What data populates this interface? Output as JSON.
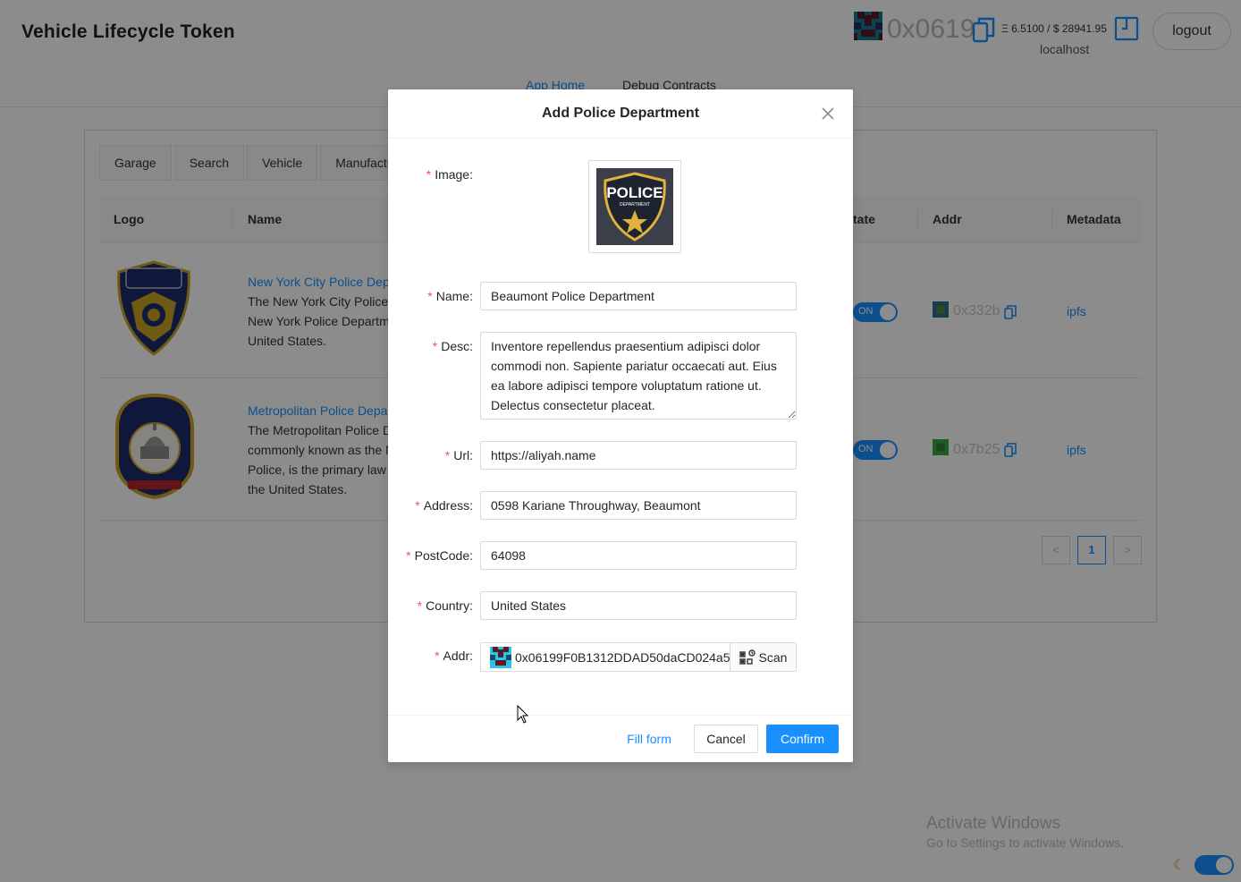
{
  "header": {
    "title": "Vehicle Lifecycle Token",
    "account_short": "0x0619",
    "balance": "Ξ 6.5100 / $ 28941.95",
    "network": "localhost",
    "logout_label": "logout",
    "nav": [
      "App Home",
      "Debug Contracts"
    ]
  },
  "tabs": [
    "Garage",
    "Search",
    "Vehicle",
    "Manufactur"
  ],
  "table": {
    "columns": [
      "Logo",
      "Name",
      "tate",
      "Addr",
      "Metadata"
    ],
    "rows": [
      {
        "name": "New York City Police Depa",
        "desc": [
          "The New York City Police",
          "New York Police Departm",
          "United States."
        ],
        "status": "ON",
        "addr": "0x332b",
        "metadata": "ipfs"
      },
      {
        "name": "Metropolitan Police Depa",
        "desc": [
          "The Metropolitan Police D",
          "commonly known as the M",
          "Police, is the primary law",
          "the United States."
        ],
        "status": "ON",
        "addr": "0x7b25",
        "metadata": "ipfs"
      }
    ],
    "pagination": {
      "prev": "<",
      "page": "1",
      "next": ">"
    }
  },
  "modal": {
    "title": "Add Police Department",
    "fields": {
      "image": {
        "label": "Image"
      },
      "name": {
        "label": "Name",
        "value": "Beaumont Police Department"
      },
      "desc": {
        "label": "Desc",
        "value": "Inventore repellendus praesentium adipisci dolor commodi non. Sapiente pariatur occaecati aut. Eius ea labore adipisci tempore voluptatum ratione ut. Delectus consectetur placeat."
      },
      "url": {
        "label": "Url",
        "value": "https://aliyah.name"
      },
      "address": {
        "label": "Address",
        "value": "0598 Kariane Throughway, Beaumont"
      },
      "postcode": {
        "label": "PostCode",
        "value": "64098"
      },
      "country": {
        "label": "Country",
        "value": "United States"
      },
      "addr": {
        "label": "Addr",
        "value": "0x06199F0B1312DDAD50daCD024a5",
        "scan_label": "Scan"
      }
    },
    "badge_text": {
      "top": "POLICE",
      "bottom": "DEPARTMENT"
    },
    "buttons": {
      "fill": "Fill form",
      "cancel": "Cancel",
      "confirm": "Confirm"
    }
  },
  "os_watermark": {
    "line1": "Activate Windows",
    "line2": "Go to Settings to activate Windows."
  },
  "colors": {
    "primary": "#1890ff",
    "required": "#ff4d4f",
    "overlay": "rgba(0,0,0,0.45)"
  }
}
